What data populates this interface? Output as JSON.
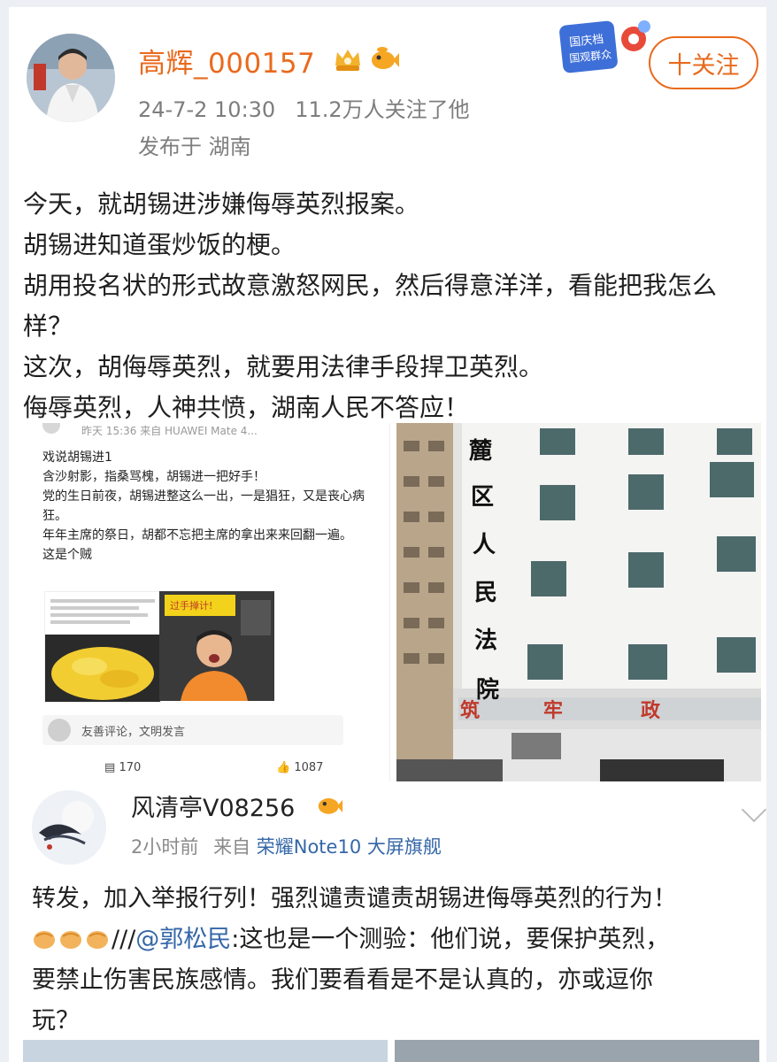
{
  "post1": {
    "username": "高辉_000157",
    "timestamp": "24-7-2 10:30",
    "followers": "11.2万人关注了他",
    "location": "发布于 湖南",
    "follow_label": "十关注",
    "promo_text": "国庆档 国观群众",
    "lines": [
      "今天，就胡锡进涉嫌侮辱英烈报案。",
      "胡锡进知道蛋炒饭的梗。",
      "胡用投名状的形式故意激怒网民，然后得意洋洋，看能把我怎么样？",
      "这次，胡侮辱英烈，就要用法律手段捍卫英烈。",
      "侮辱英烈，人神共愤，湖南人民不答应！"
    ]
  },
  "embedded_screenshot": {
    "meta": "昨天 15:36  来自 HUAWEI Mate 4...",
    "title": "戏说胡锡进1",
    "lines": [
      "含沙射影，指桑骂槐，胡锡进一把好手！",
      "党的生日前夜，胡锡进整这么一出，一是猖狂，又是丧心病狂。",
      "年年主席的祭日，胡都不忘把主席的拿出来来回翻一遍。",
      "这是个贼"
    ],
    "thumb_caption": "过手掸计!",
    "comment_placeholder": "友善评论，文明发言",
    "comments_count": "170",
    "likes_count": "1087"
  },
  "court_photo": {
    "vertical_sign": [
      "麓",
      "区",
      "人",
      "民",
      "法",
      "院"
    ],
    "banner": [
      "筑",
      "牢",
      "政"
    ]
  },
  "post2": {
    "username": "风清亭V08256",
    "time": "2小时前",
    "source_prefix": "来自",
    "device": "荣耀Note10 大屏旗舰",
    "line1": "转发，加入举报行列！强烈谴责谴责胡锡进侮辱英烈的行为！",
    "slashes": "///",
    "mention": "@郭松民",
    "line2_rest": ":这也是一个测验：他们说，要保护英烈，",
    "line3": "要禁止伤害民族感情。我们要看看是不是认真的，亦或逗你",
    "line4": "玩？"
  },
  "colors": {
    "accent_orange": "#e96a1d",
    "link_blue": "#3567a8"
  }
}
